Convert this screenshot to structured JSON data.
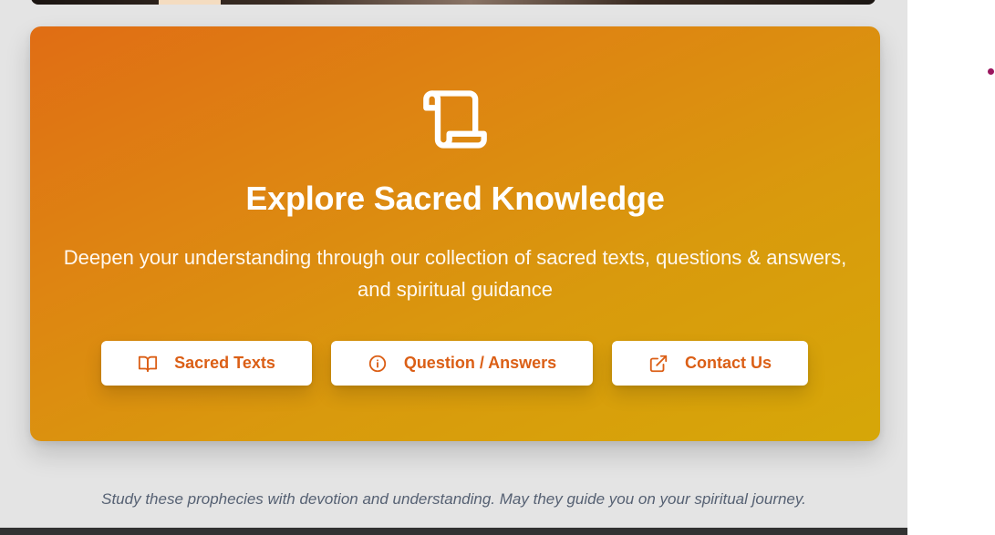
{
  "cta": {
    "icon": "scroll-icon",
    "title": "Explore Sacred Knowledge",
    "subtitle": "Deepen your understanding through our collection of sacred texts, questions & answers, and spiritual guidance",
    "buttons": [
      {
        "label": "Sacred Texts",
        "icon": "book-open-icon"
      },
      {
        "label": "Question / Answers",
        "icon": "info-circle-icon"
      },
      {
        "label": "Contact Us",
        "icon": "external-link-icon"
      }
    ]
  },
  "footer": {
    "note": "Study these prophecies with devotion and understanding. May they guide you on your spiritual journey."
  },
  "colors": {
    "gradient_start": "#e06d14",
    "gradient_end": "#d6a708",
    "button_text": "#db5f16",
    "bullet": "#9a165e"
  }
}
